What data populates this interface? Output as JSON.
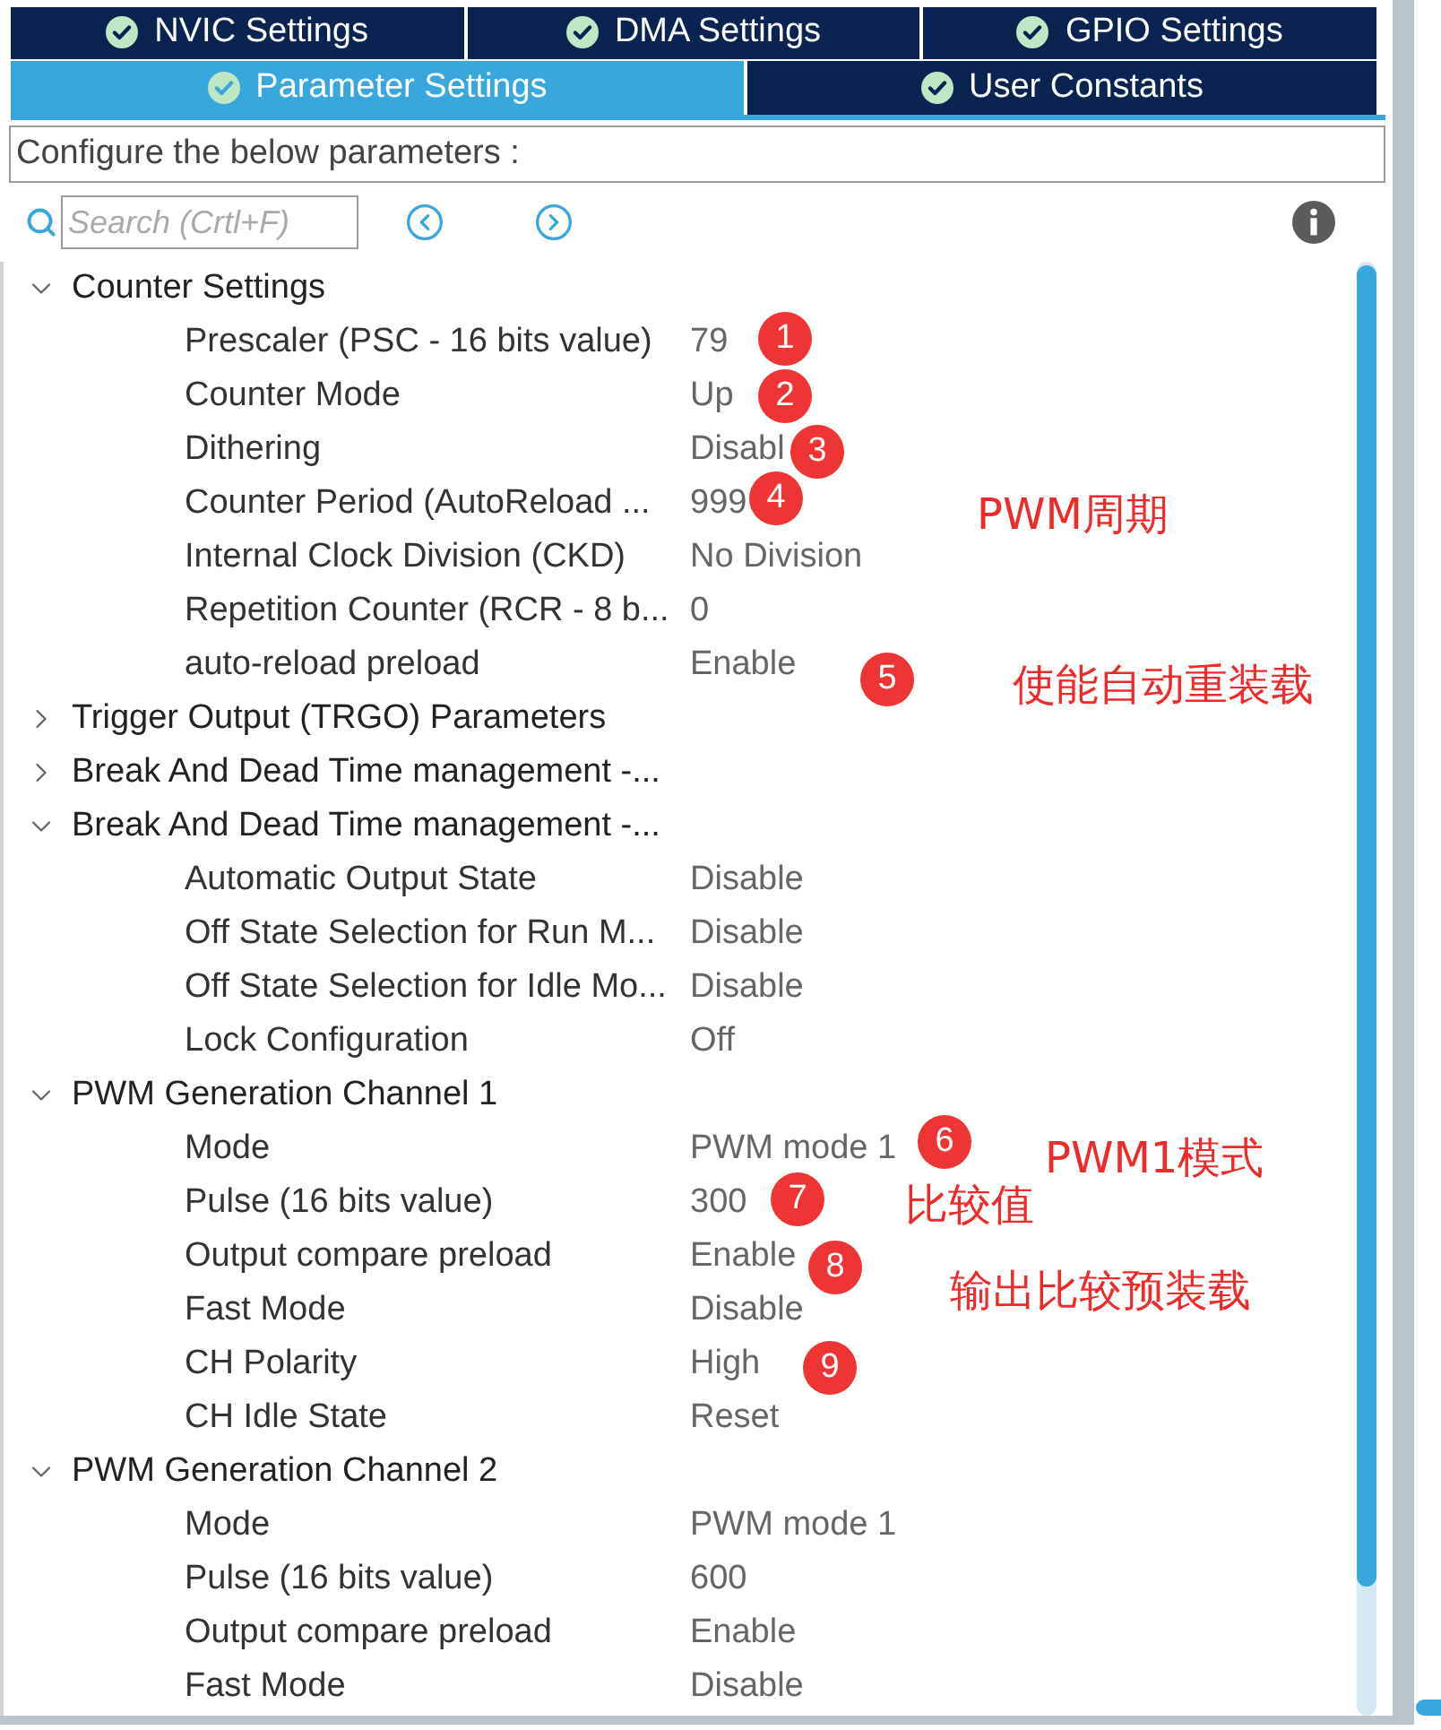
{
  "tab_rows": [
    {
      "tabs": [
        {
          "label": "NVIC Settings",
          "selected": false
        },
        {
          "label": "DMA Settings",
          "selected": false
        },
        {
          "label": "GPIO Settings",
          "selected": false
        }
      ]
    },
    {
      "tabs": [
        {
          "label": "Parameter Settings",
          "selected": true
        },
        {
          "label": "User Constants",
          "selected": false
        }
      ]
    }
  ],
  "description": "Configure the below parameters :",
  "search": {
    "placeholder": "Search (Crtl+F)"
  },
  "tree": [
    {
      "label": "Counter Settings",
      "expanded": true,
      "children": [
        {
          "label": "Prescaler (PSC - 16 bits value)",
          "value": "79"
        },
        {
          "label": "Counter Mode",
          "value": "Up"
        },
        {
          "label": "Dithering",
          "value": "Disabl"
        },
        {
          "label": "Counter Period (AutoReload ...",
          "value": "999"
        },
        {
          "label": "Internal Clock Division (CKD)",
          "value": "No Division"
        },
        {
          "label": "Repetition Counter (RCR - 8 b...",
          "value": "0"
        },
        {
          "label": "auto-reload preload",
          "value": "Enable"
        }
      ]
    },
    {
      "label": "Trigger Output (TRGO) Parameters",
      "expanded": false
    },
    {
      "label": "Break And Dead Time management -...",
      "expanded": false
    },
    {
      "label": "Break And Dead Time management -...",
      "expanded": true,
      "children": [
        {
          "label": "Automatic Output State",
          "value": "Disable"
        },
        {
          "label": "Off State Selection for Run M...",
          "value": "Disable"
        },
        {
          "label": "Off State Selection for Idle Mo...",
          "value": "Disable"
        },
        {
          "label": "Lock Configuration",
          "value": "Off"
        }
      ]
    },
    {
      "label": "PWM Generation Channel 1",
      "expanded": true,
      "children": [
        {
          "label": "Mode",
          "value": "PWM mode 1"
        },
        {
          "label": "Pulse (16 bits value)",
          "value": "300"
        },
        {
          "label": "Output compare preload",
          "value": "Enable"
        },
        {
          "label": "Fast Mode",
          "value": "Disable"
        },
        {
          "label": "CH Polarity",
          "value": "High"
        },
        {
          "label": "CH Idle State",
          "value": "Reset"
        }
      ]
    },
    {
      "label": "PWM Generation Channel 2",
      "expanded": true,
      "children": [
        {
          "label": "Mode",
          "value": "PWM mode 1"
        },
        {
          "label": "Pulse (16 bits value)",
          "value": "600"
        },
        {
          "label": "Output compare preload",
          "value": "Enable"
        },
        {
          "label": "Fast Mode",
          "value": "Disable"
        }
      ]
    }
  ],
  "annotations": {
    "markers": [
      "1",
      "2",
      "3",
      "4",
      "5",
      "6",
      "7",
      "8",
      "9"
    ],
    "notes": [
      "PWM周期",
      "使能自动重装载",
      "PWM1模式",
      "比较值",
      "输出比较预装载"
    ]
  }
}
